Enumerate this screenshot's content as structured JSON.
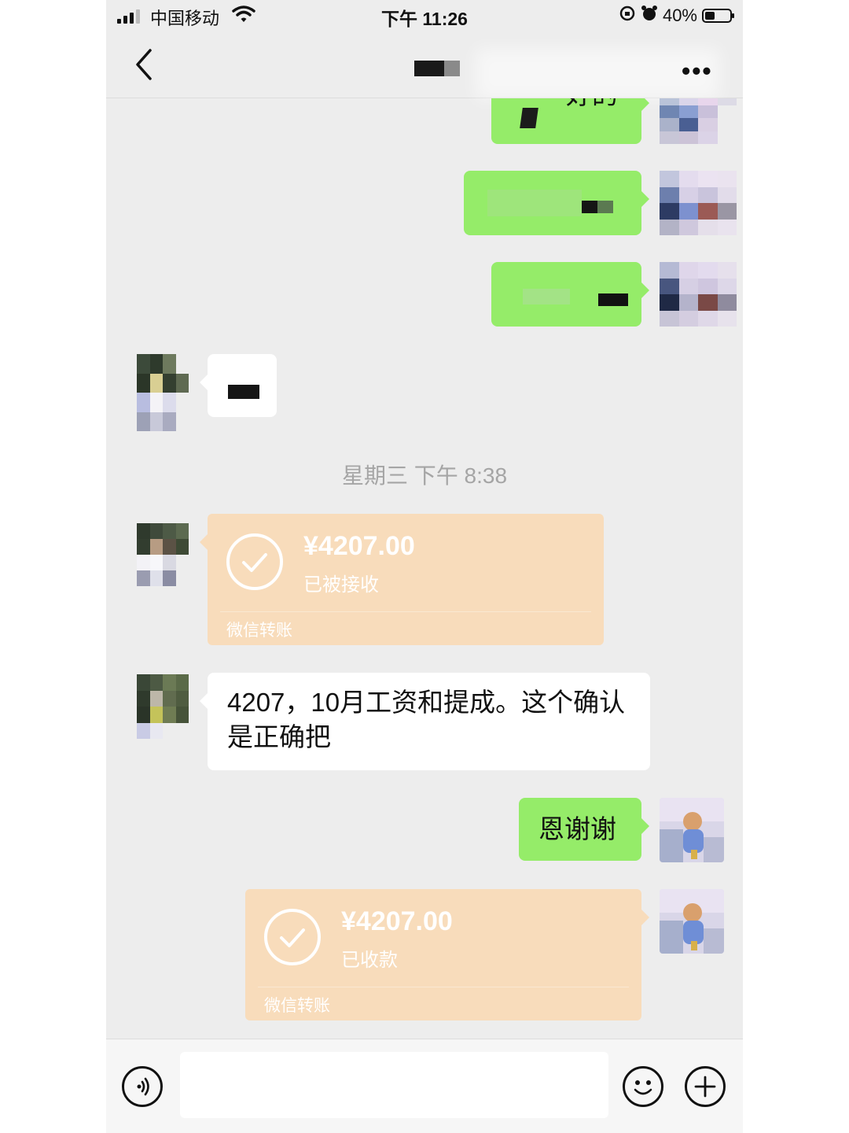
{
  "status_bar": {
    "carrier": "中国移动",
    "time": "下午 11:26",
    "battery": "40%",
    "battery_level": 0.4
  },
  "nav": {
    "back_icon": "chevron-left-icon",
    "more_icon": "ellipsis-icon",
    "more_label": "•••"
  },
  "messages": {
    "sent_partial": "好的",
    "timestamp": "星期三 下午 8:38",
    "transfer_in": {
      "amount": "¥4207.00",
      "status": "已被接收",
      "footer": "微信转账"
    },
    "text_in": "4207，10月工资和提成。这个确认是正确把",
    "text_out": "恩谢谢",
    "transfer_out": {
      "amount": "¥4207.00",
      "status": "已收款",
      "footer": "微信转账"
    }
  },
  "input_bar": {
    "voice_icon": "voice-icon",
    "emoji_icon": "emoji-icon",
    "plus_icon": "plus-icon"
  },
  "colors": {
    "green_bubble": "#95ec69",
    "transfer_bubble": "#f8dcbb",
    "background": "#ededed"
  }
}
